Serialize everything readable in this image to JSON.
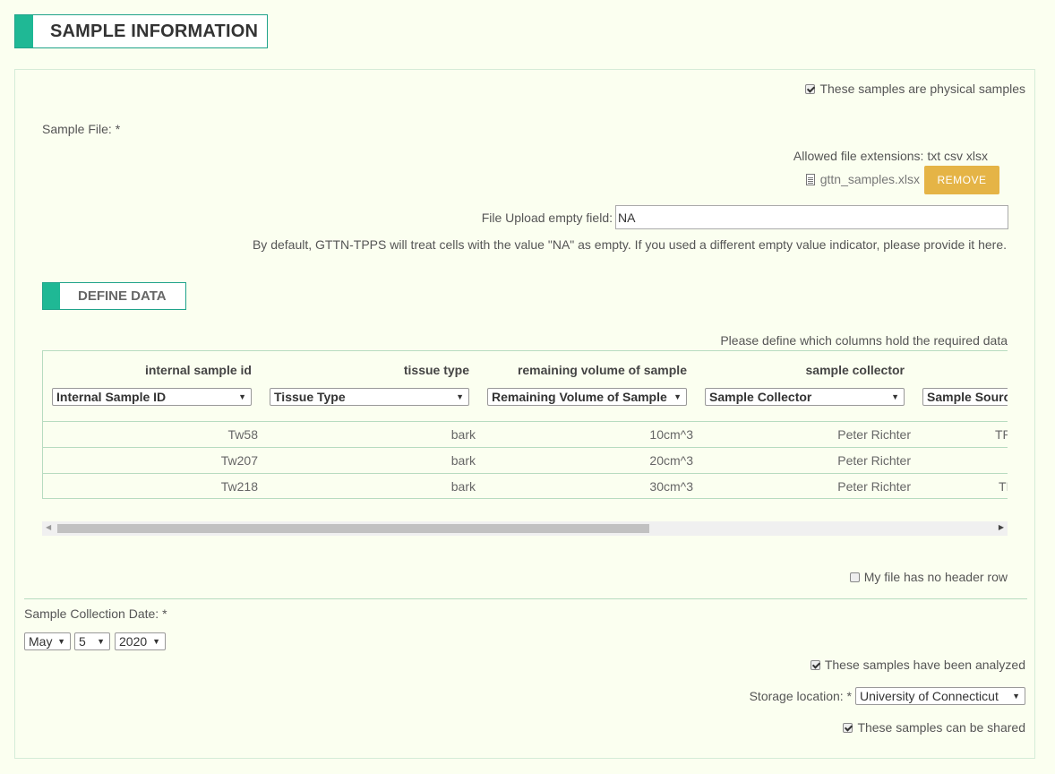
{
  "section_title": "SAMPLE INFORMATION",
  "physical_samples": {
    "label": "These samples are physical samples",
    "checked": true
  },
  "sample_file": {
    "label": "Sample File: *",
    "allowed_ext": "Allowed file extensions: txt csv xlsx",
    "filename": "gttn_samples.xlsx",
    "remove_label": "REMOVE",
    "file_icon": "file-icon"
  },
  "empty_field": {
    "label": "File Upload empty field:",
    "value": "NA",
    "help": "By default, GTTN-TPPS will treat cells with the value \"NA\" as empty. If you used a different empty value indicator, please provide it here."
  },
  "define_data": {
    "title": "DEFINE DATA",
    "instructions": "Please define which columns hold the required data",
    "columns": [
      {
        "header": "internal sample id",
        "select": "Internal Sample ID"
      },
      {
        "header": "tissue type",
        "select": "Tissue Type"
      },
      {
        "header": "remaining volume of sample",
        "select": "Remaining Volume of Sample"
      },
      {
        "header": "sample collector",
        "select": "Sample Collector"
      },
      {
        "header": "",
        "select": "Sample Source"
      }
    ],
    "rows": [
      [
        "Tw58",
        "bark",
        "10cm^3",
        "Peter Richter",
        "TP"
      ],
      [
        "Tw207",
        "bark",
        "20cm^3",
        "Peter Richter",
        ""
      ],
      [
        "Tw218",
        "bark",
        "30cm^3",
        "Peter Richter",
        "TI"
      ]
    ],
    "no_header": {
      "label": "My file has no header row",
      "checked": false
    }
  },
  "collection_date": {
    "label": "Sample Collection Date: *",
    "month": "May",
    "day": "5",
    "year": "2020"
  },
  "analyzed": {
    "label": "These samples have been analyzed",
    "checked": true
  },
  "storage": {
    "label": "Storage location: *",
    "value": "University of Connecticut"
  },
  "shared": {
    "label": "These samples can be shared",
    "checked": true
  },
  "colors": {
    "accent": "#1fb895",
    "button": "#e5b446",
    "background": "#fbfff0"
  }
}
